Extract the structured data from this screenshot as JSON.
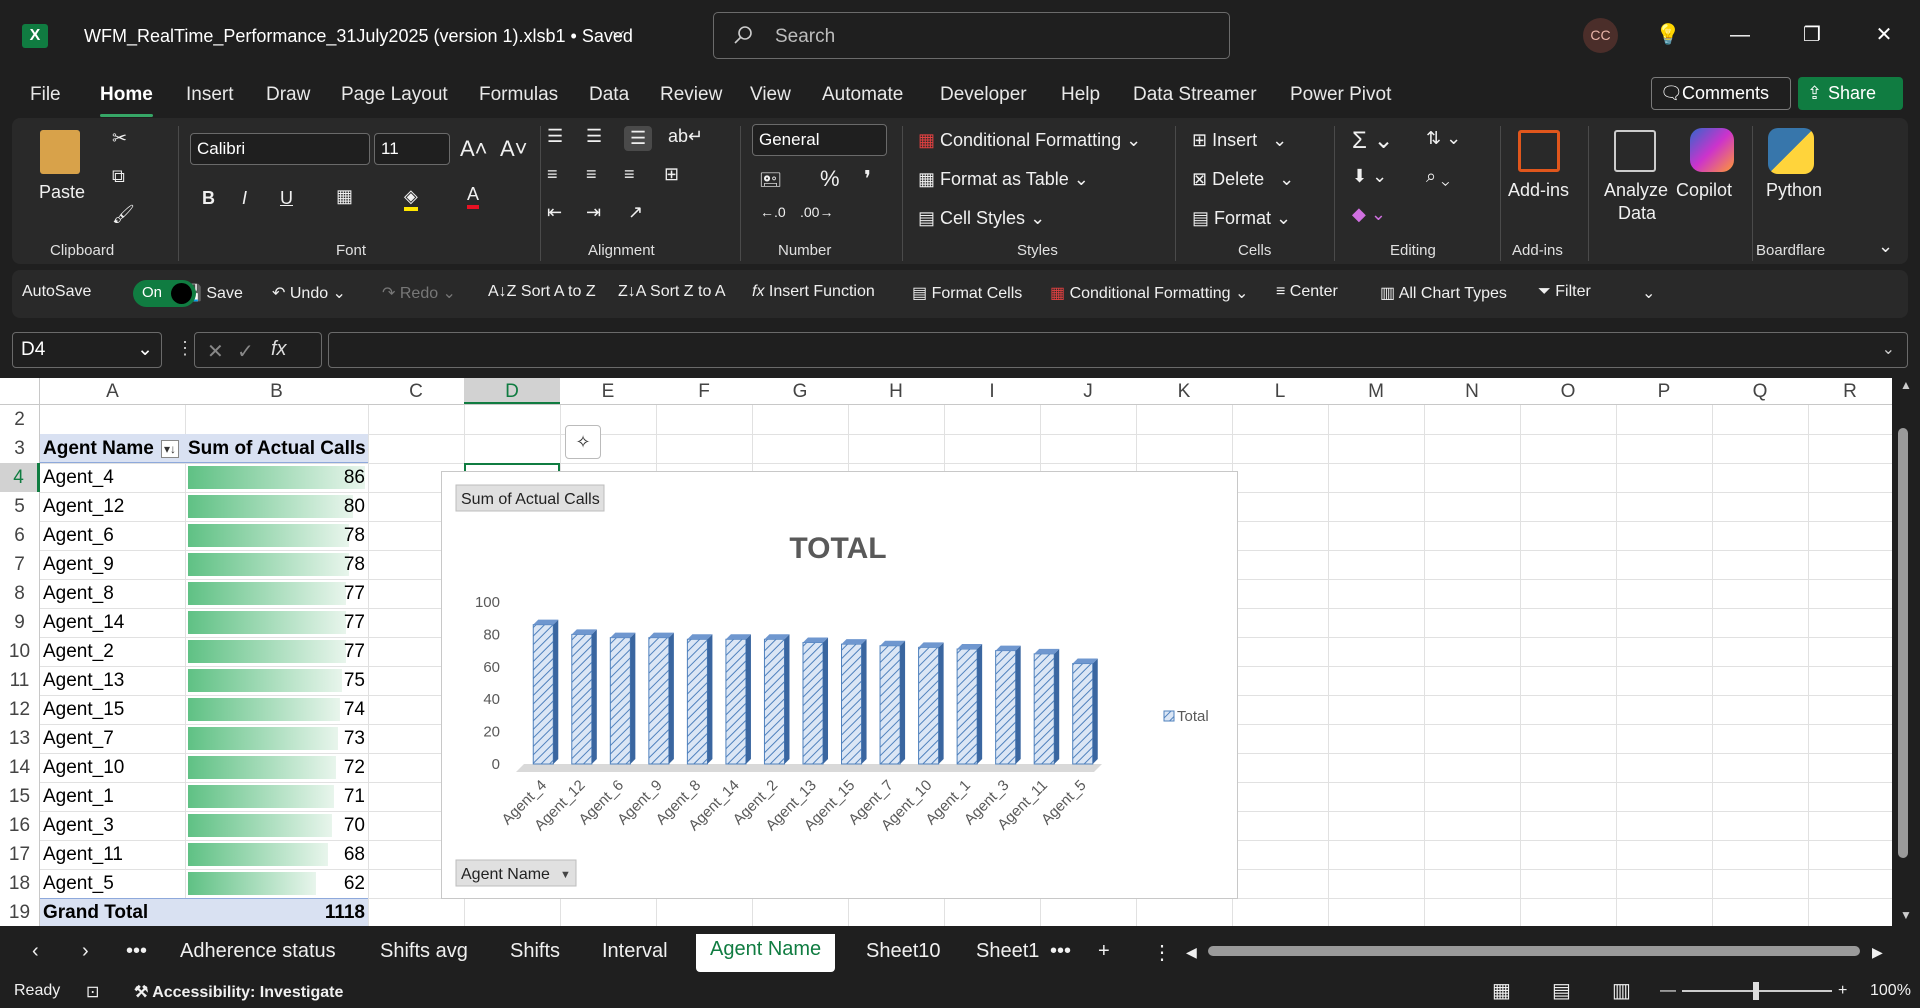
{
  "window": {
    "doc_title": "WFM_RealTime_Performance_31July2025 (version 1).xlsb1 • Saved",
    "search_placeholder": "Search",
    "user_initials": "CC"
  },
  "tabs": [
    "File",
    "Home",
    "Insert",
    "Draw",
    "Page Layout",
    "Formulas",
    "Data",
    "Review",
    "View",
    "Automate",
    "Developer",
    "Help",
    "Data Streamer",
    "Power Pivot"
  ],
  "buttons": {
    "comments": "Comments",
    "share": "Share"
  },
  "ribbon": {
    "paste": "Paste",
    "clipboard": "Clipboard",
    "font_name": "Calibri",
    "font_size": "11",
    "font": "Font",
    "alignment": "Alignment",
    "number_format": "General",
    "number": "Number",
    "conditional_formatting": "Conditional Formatting",
    "format_as_table": "Format as Table",
    "cell_styles": "Cell Styles",
    "styles": "Styles",
    "insert": "Insert",
    "delete": "Delete",
    "format": "Format",
    "cells": "Cells",
    "editing": "Editing",
    "addins": "Add-ins",
    "addins_group": "Add-ins",
    "analyze": "Analyze",
    "data": "Data",
    "copilot": "Copilot",
    "python": "Python",
    "boardflare": "Boardflare"
  },
  "qat": {
    "autosave": "AutoSave",
    "toggle": "On",
    "save": "Save",
    "undo": "Undo",
    "redo": "Redo",
    "sort_az": "Sort A to Z",
    "sort_za": "Sort Z to A",
    "insert_function": "Insert Function",
    "format_cells": "Format Cells",
    "conditional_formatting": "Conditional Formatting",
    "center": "Center",
    "all_chart_types": "All Chart Types",
    "filter": "Filter"
  },
  "formula": {
    "name_box": "D4",
    "fx": "fx",
    "content": ""
  },
  "columns": [
    "A",
    "B",
    "C",
    "D",
    "E",
    "F",
    "G",
    "H",
    "I",
    "J",
    "K",
    "L",
    "M",
    "N",
    "O",
    "P",
    "Q",
    "R"
  ],
  "rows": [
    "2",
    "3",
    "4",
    "5",
    "6",
    "7",
    "8",
    "9",
    "10",
    "11",
    "12",
    "13",
    "14",
    "15",
    "16",
    "17",
    "18",
    "19"
  ],
  "pivot": {
    "header_a": "Agent Name",
    "header_b": "Sum of Actual Calls",
    "records": [
      {
        "name": "Agent_4",
        "value": 86
      },
      {
        "name": "Agent_12",
        "value": 80
      },
      {
        "name": "Agent_6",
        "value": 78
      },
      {
        "name": "Agent_9",
        "value": 78
      },
      {
        "name": "Agent_8",
        "value": 77
      },
      {
        "name": "Agent_14",
        "value": 77
      },
      {
        "name": "Agent_2",
        "value": 77
      },
      {
        "name": "Agent_13",
        "value": 75
      },
      {
        "name": "Agent_15",
        "value": 74
      },
      {
        "name": "Agent_7",
        "value": 73
      },
      {
        "name": "Agent_10",
        "value": 72
      },
      {
        "name": "Agent_1",
        "value": 71
      },
      {
        "name": "Agent_3",
        "value": 70
      },
      {
        "name": "Agent_11",
        "value": 68
      },
      {
        "name": "Agent_5",
        "value": 62
      }
    ],
    "grand_total_label": "Grand Total",
    "grand_total": "1118"
  },
  "chart_data": {
    "type": "bar",
    "title": "TOTAL",
    "field_button": "Sum of Actual Calls",
    "axis_button": "Agent Name",
    "legend": "Total",
    "legend_position": "right",
    "categories": [
      "Agent_4",
      "Agent_12",
      "Agent_6",
      "Agent_9",
      "Agent_8",
      "Agent_14",
      "Agent_2",
      "Agent_13",
      "Agent_15",
      "Agent_7",
      "Agent_10",
      "Agent_1",
      "Agent_3",
      "Agent_11",
      "Agent_5"
    ],
    "series": [
      {
        "name": "Total",
        "values": [
          86,
          80,
          78,
          78,
          77,
          77,
          77,
          75,
          74,
          73,
          72,
          71,
          70,
          68,
          62
        ]
      }
    ],
    "ylim": [
      0,
      100
    ],
    "yticks": [
      "0",
      "20",
      "40",
      "60",
      "80",
      "100"
    ],
    "grid": false
  },
  "sheets": [
    "Adherence status",
    "Shifts avg",
    "Shifts",
    "Interval",
    "Agent Name",
    "Sheet10",
    "Sheet1"
  ],
  "active_sheet": "Agent Name",
  "status": {
    "ready": "Ready",
    "accessibility": "Accessibility: Investigate",
    "zoom": "100%"
  }
}
